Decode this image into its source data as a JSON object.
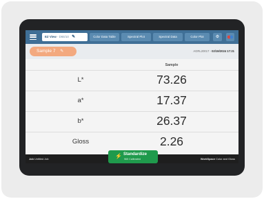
{
  "tabs": [
    {
      "label": "EZ View",
      "sublabel": "- D65/10"
    },
    {
      "label": "Color Data Table"
    },
    {
      "label": "Spectral Plot"
    },
    {
      "label": "Spectral Data"
    },
    {
      "label": "Color Plot"
    }
  ],
  "sample": {
    "name": "Sample 7",
    "serial": "AGRL20017",
    "datetime": "02/19/2024 17:21"
  },
  "table": {
    "column_header": "Sample",
    "rows": [
      {
        "label": "L*",
        "value": "73.26"
      },
      {
        "label": "a*",
        "value": "17.37"
      },
      {
        "label": "b*",
        "value": "26.37"
      },
      {
        "label": "Gloss",
        "value": "2.26"
      }
    ]
  },
  "bottom": {
    "job_label": "Job",
    "job_value": "Untitled Job",
    "workspace_label": "WorkSpace",
    "workspace_value": "Color and Gloss"
  },
  "standardize": {
    "label": "Standardize",
    "status": "965 Calibrated"
  },
  "icons": {
    "menu": "hamburger-menu-icon",
    "edit": "pencil-icon",
    "layout": "grid-settings-icon",
    "palette": "color-palette-icon",
    "standardize": "lightning-bolt-icon"
  },
  "colors": {
    "topbar": "#3f6f96",
    "sample_pill": "#f3a97f",
    "standardize": "#1f9a4c"
  }
}
